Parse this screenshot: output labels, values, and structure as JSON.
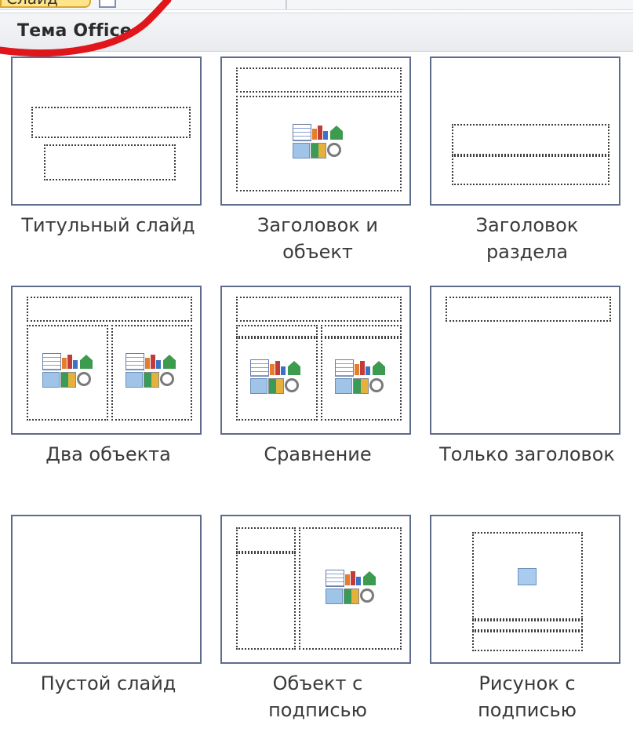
{
  "top": {
    "tab_label": "Слайд"
  },
  "header": {
    "title": "Тема Office"
  },
  "layouts": [
    {
      "label_line1": "Титульный слайд",
      "label_line2": ""
    },
    {
      "label_line1": "Заголовок и",
      "label_line2": "объект"
    },
    {
      "label_line1": "Заголовок",
      "label_line2": "раздела"
    },
    {
      "label_line1": "Два объекта",
      "label_line2": ""
    },
    {
      "label_line1": "Сравнение",
      "label_line2": ""
    },
    {
      "label_line1": "Только заголовок",
      "label_line2": ""
    },
    {
      "label_line1": "Пустой слайд",
      "label_line2": ""
    },
    {
      "label_line1": "Объект с",
      "label_line2": "подписью"
    },
    {
      "label_line1": "Рисунок с",
      "label_line2": "подписью"
    }
  ],
  "colors": {
    "annotation": "#e0161a",
    "thumb_border": "#5d6b8c",
    "header_bg": "#eceef2"
  },
  "icons": {
    "content_placeholder": "insert-content-icon",
    "picture_placeholder": "picture-icon"
  }
}
